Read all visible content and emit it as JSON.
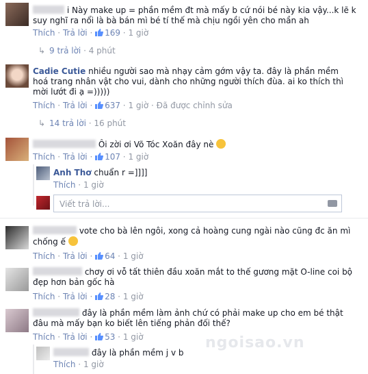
{
  "colors": {
    "link": "#3b5998",
    "action": "#6d84b4",
    "meta": "#9197a3"
  },
  "comments": [
    {
      "id": "c1",
      "text": "i Này make up = phần mềm đt mà mấy b cứ nói bé này kia vậy...k lẽ k suy nghĩ ra nổi là bà bán mì bé tí thế mà chịu ngồi yên cho mần ah",
      "like": "Thích",
      "reply": "Trả lời",
      "likes": "169",
      "time": "1 giờ",
      "replies": "9 trả lời",
      "replies_time": "4 phút"
    },
    {
      "id": "c2",
      "name": "Cadie Cutie",
      "text": "nhiều người sao mà nhạy cảm gớm vậy ta. đây là phần mềm hoá trang nhân vật cho vui, dành cho những người thích đùa. ai ko thích thì mời lướt đi ạ =)))))",
      "like": "Thích",
      "reply": "Trả lời",
      "likes": "637",
      "time": "1 giờ",
      "edited": "Đã được chỉnh sửa",
      "replies": "14 trả lời",
      "replies_time": "16 phút"
    },
    {
      "id": "c3",
      "text": "Ôi zời ơi Võ Tóc Xoăn đây nè",
      "like": "Thích",
      "reply": "Trả lời",
      "likes": "107",
      "time": "1 giờ",
      "sub": {
        "name": "Anh Thơ",
        "text": "chuẩn r =]]]]",
        "like": "Thích",
        "time": "1 giờ"
      },
      "reply_placeholder": "Viết trả lời..."
    },
    {
      "id": "c4",
      "text": "vote cho bà lên ngôi, xong cả hoàng cung ngài nào cũng đc ăn mì chống ế",
      "like": "Thích",
      "reply": "Trả lời",
      "likes": "64",
      "time": "1 giờ"
    },
    {
      "id": "c5",
      "text": "chơy ơi vỗ tất thiên đầu xoăn mắt to thế gương mặt O-line coi bộ đẹp hơn bản gốc hà",
      "like": "Thích",
      "reply": "Trả lời",
      "likes": "28",
      "time": "1 giờ"
    },
    {
      "id": "c6",
      "text": "đây là phần mềm làm ảnh chứ có phải make up cho em bé thật đâu mà mấy bạn ko biết lên tiếng phản đối thế?",
      "like": "Thích",
      "reply": "Trả lời",
      "likes": "53",
      "time": "1 giờ",
      "sub": {
        "text": "đây là phần mềm j v b",
        "like": "Thích",
        "time": "1 giờ"
      }
    }
  ],
  "watermark": "ngoisao.vn"
}
